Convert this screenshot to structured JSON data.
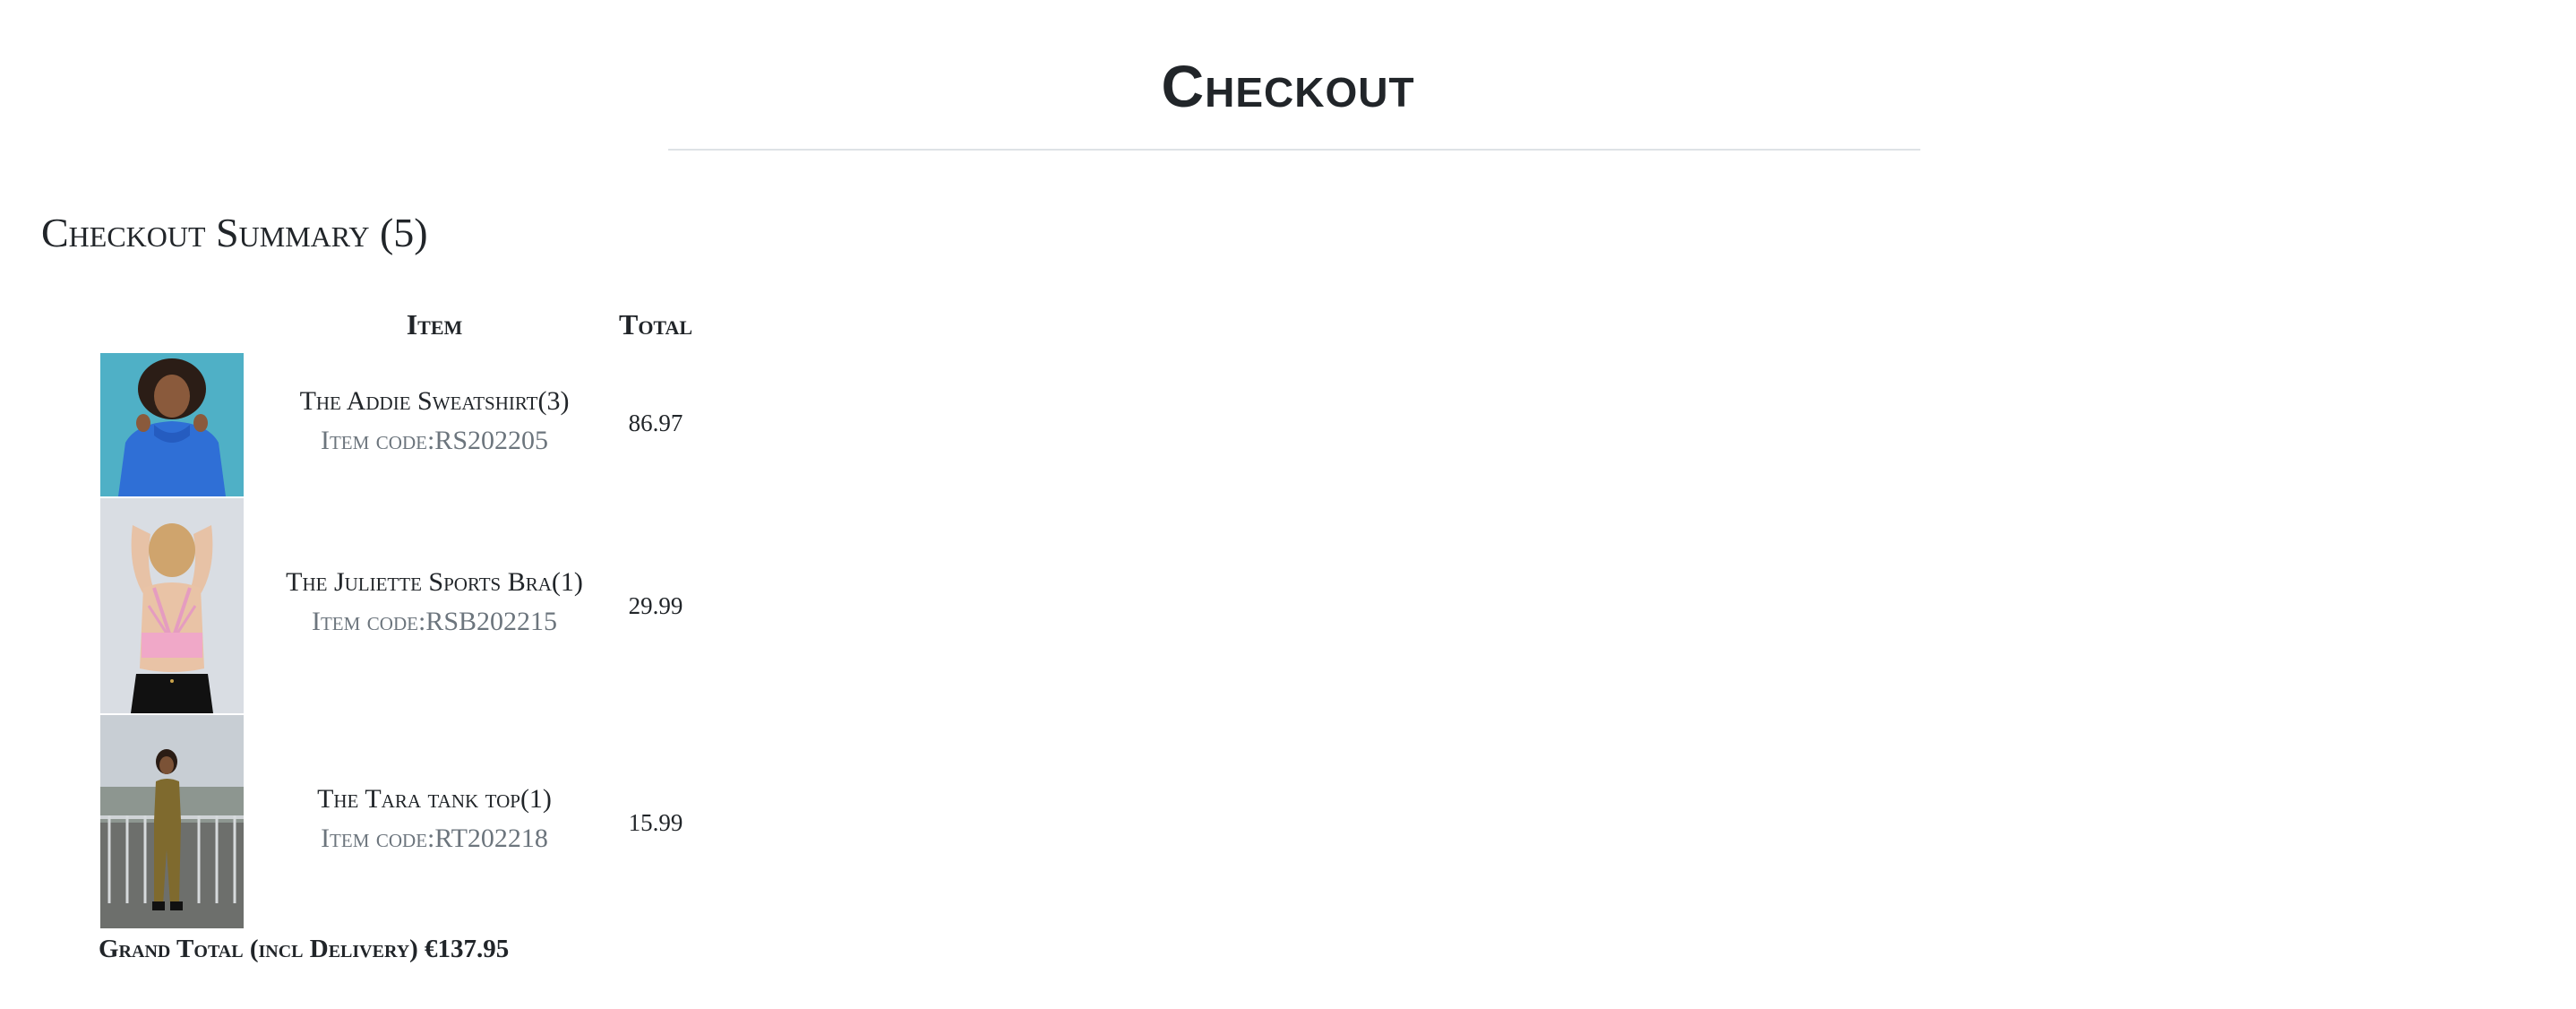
{
  "page": {
    "title": "Checkout"
  },
  "summary": {
    "heading": "Checkout Summary (5)"
  },
  "table": {
    "columns": {
      "item": "Item",
      "total": "Total"
    },
    "rows": [
      {
        "name": "The Addie Sweatshirt(3)",
        "code": "Item code:RS202205",
        "total": "86.97",
        "image": "sweatshirt-product-photo"
      },
      {
        "name": "The Juliette Sports Bra(1)",
        "code": "Item code:RSB202215",
        "total": "29.99",
        "image": "sports-bra-product-photo"
      },
      {
        "name": "The Tara tank top(1)",
        "code": "Item code:RT202218",
        "total": "15.99",
        "image": "tank-top-product-photo"
      }
    ]
  },
  "grand_total": {
    "label": "Grand Total (incl Delivery) €137.95"
  }
}
